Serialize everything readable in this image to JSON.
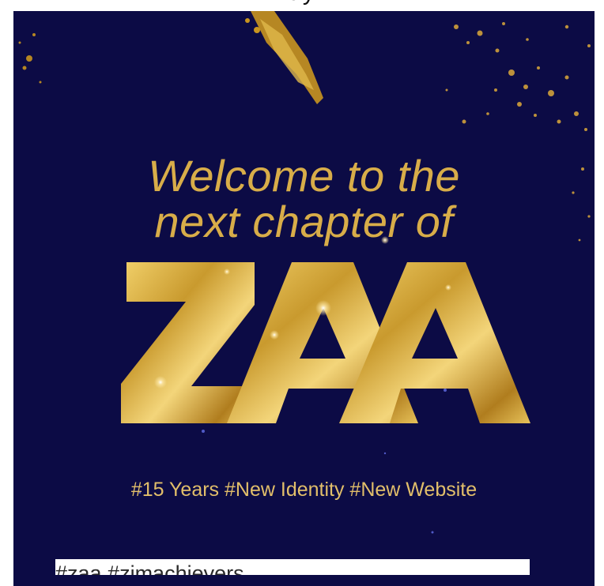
{
  "page": {
    "header_text": "ay"
  },
  "post": {
    "background_color": "#0c0b45",
    "accent_color": "#d8ad49",
    "welcome_line1": "Welcome to the",
    "welcome_line2": "next chapter of",
    "brand_logo_text": "ZAA",
    "hashtags": "#15 Years #New Identity #New Website",
    "caption": "#zaa #zimachievers"
  }
}
